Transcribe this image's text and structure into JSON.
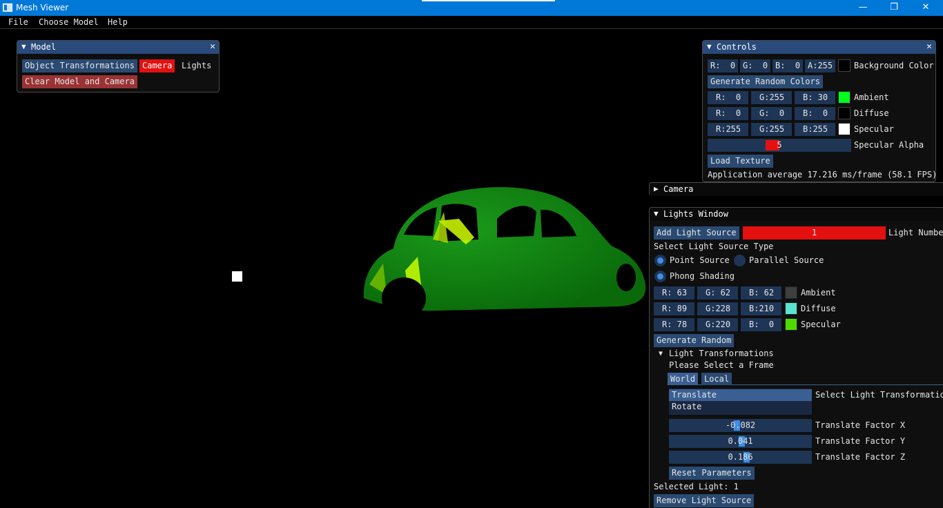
{
  "window": {
    "title": "Mesh Viewer",
    "minimize": "—",
    "maximize": "❐",
    "close": "✕"
  },
  "menu": {
    "items": [
      "File",
      "Choose Model",
      "Help"
    ]
  },
  "model_window": {
    "title": "Model",
    "buttons": {
      "object_transformations": "Object Transformations",
      "camera": "Camera",
      "lights": "Lights",
      "clear": "Clear Model and Camera"
    }
  },
  "controls_window": {
    "title": "Controls",
    "background": {
      "r": "R:  0",
      "g": "G:  0",
      "b": "B:  0",
      "a": "A:255",
      "label": "Background Color",
      "color": "#000000"
    },
    "generate_random_colors": "Generate Random Colors",
    "ambient": {
      "r": "R:  0",
      "g": "G:255",
      "b": "B: 30",
      "label": "Ambient",
      "color": "#00ff1e"
    },
    "diffuse": {
      "r": "R:  0",
      "g": "G:  0",
      "b": "B:  0",
      "label": "Diffuse",
      "color": "#000000"
    },
    "specular": {
      "r": "R:255",
      "g": "G:255",
      "b": "B:255",
      "label": "Specular",
      "color": "#ffffff"
    },
    "specular_alpha": {
      "value": "5",
      "label": "Specular Alpha"
    },
    "load_texture": "Load Texture",
    "fps": "Application average 17.216 ms/frame (58.1 FPS)"
  },
  "camera_window": {
    "title": "Camera"
  },
  "lights_window": {
    "title": "Lights Window",
    "add_light": "Add Light Source",
    "light_number": {
      "value": "1",
      "label": "Light Number"
    },
    "select_type_label": "Select Light Source Type",
    "point_source": "Point Source",
    "parallel_source": "Parallel Source",
    "phong_shading": "Phong Shading",
    "ambient": {
      "r": "R: 63",
      "g": "G: 62",
      "b": "B: 62",
      "label": "Ambient",
      "color": "#3f3e3e"
    },
    "diffuse": {
      "r": "R: 89",
      "g": "G:228",
      "b": "B:210",
      "label": "Diffuse",
      "color": "#59e4d2"
    },
    "specular": {
      "r": "R: 78",
      "g": "G:220",
      "b": "B:  0",
      "label": "Specular",
      "color": "#4edc00"
    },
    "generate_random": "Generate Random",
    "light_transformations": "Light Transformations",
    "select_frame": "Please Select a Frame",
    "tabs": {
      "world": "World",
      "local": "Local"
    },
    "transform_list": {
      "translate": "Translate",
      "rotate": "Rotate",
      "label": "Select Light Transformation"
    },
    "translate_x": {
      "value": "-0.082",
      "label": "Translate Factor X"
    },
    "translate_y": {
      "value": "0.041",
      "label": "Translate Factor Y"
    },
    "translate_z": {
      "value": "0.186",
      "label": "Translate Factor Z"
    },
    "reset": "Reset Parameters",
    "selected_light": "Selected Light: 1",
    "remove_light": "Remove Light Source"
  },
  "colors": {
    "titlebar": "#0078d7",
    "imgui_button": "#2a4a72",
    "active_red": "#e41010",
    "mesh_green": "#0a7a0a",
    "highlight": "#ccff00"
  }
}
